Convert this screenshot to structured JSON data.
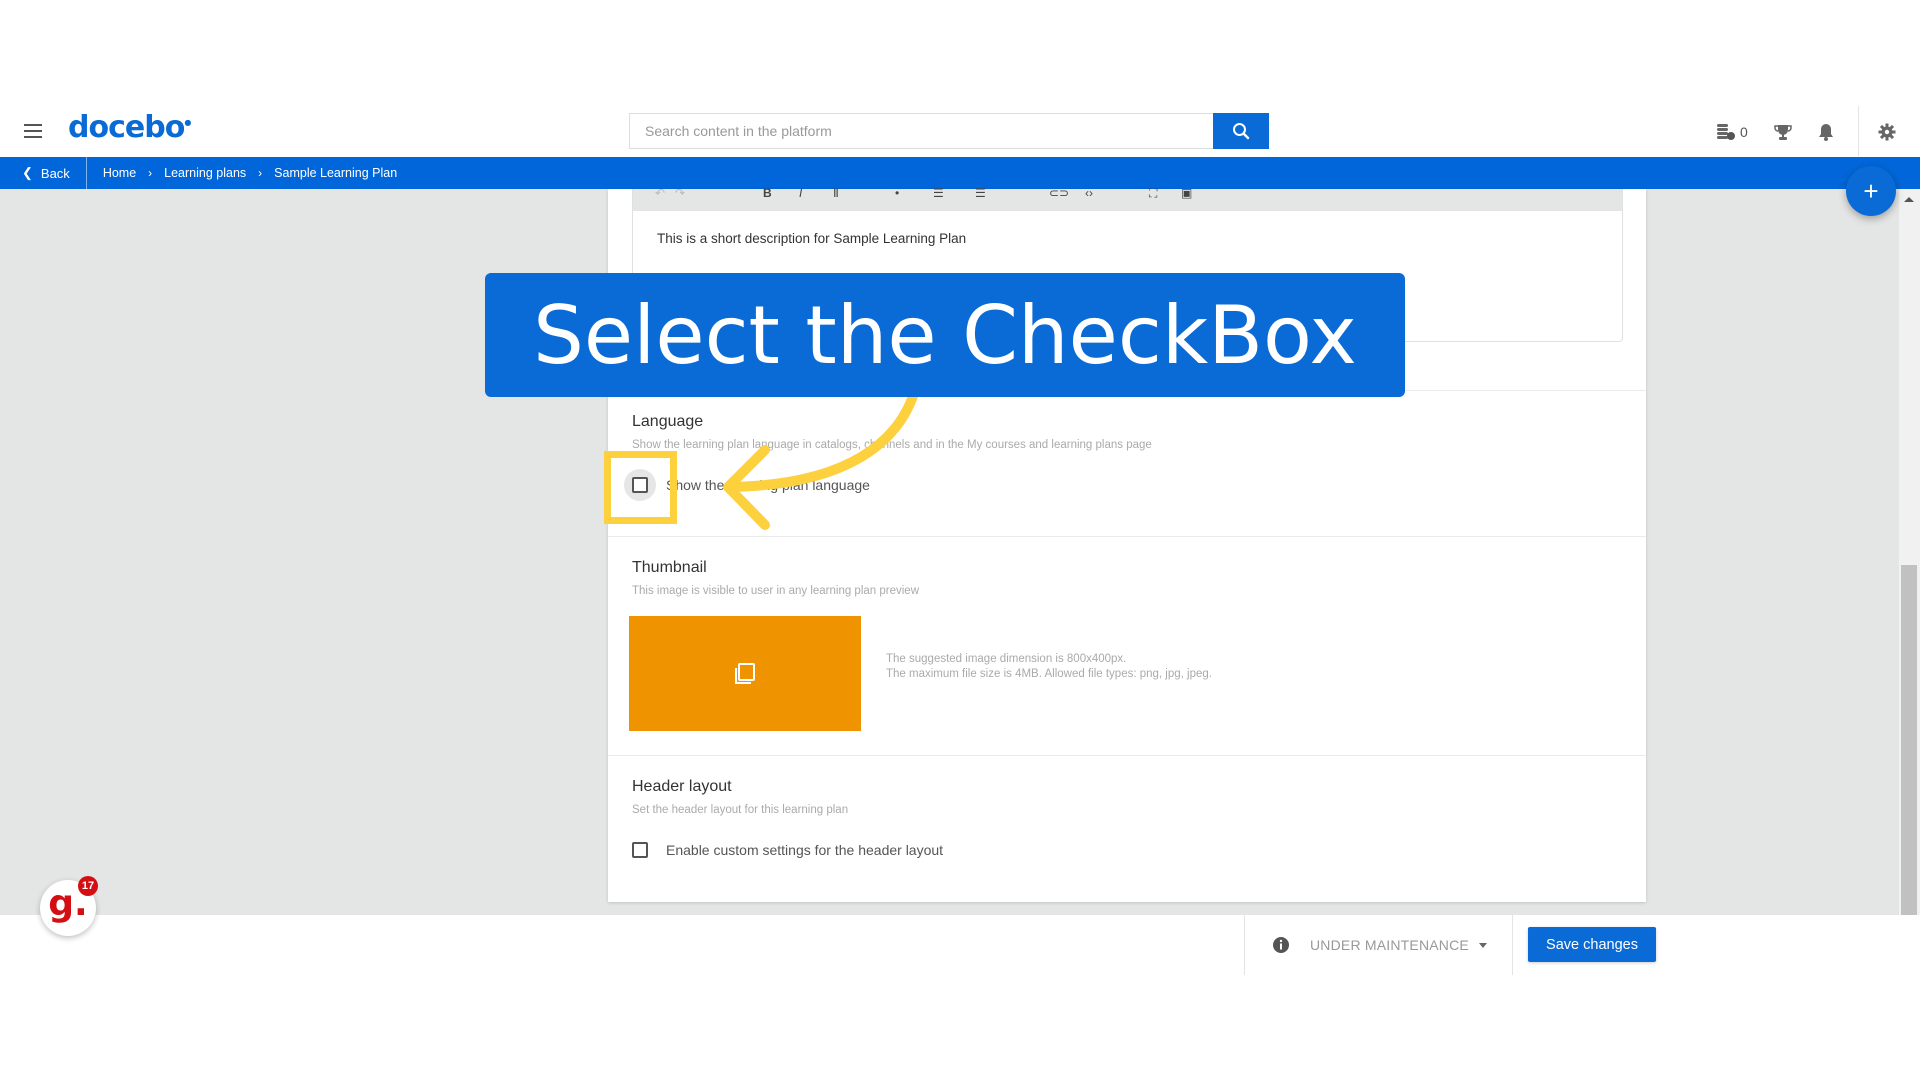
{
  "header": {
    "logo": "docebo",
    "search": {
      "placeholder": "Search content in the platform",
      "value": ""
    },
    "coins_count": "0",
    "icons": [
      "menu-icon",
      "search-icon",
      "coins-icon",
      "trophy-icon",
      "bell-icon",
      "gear-icon"
    ]
  },
  "breadcrumb": {
    "back_label": "Back",
    "items": [
      "Home",
      "Learning plans",
      "Sample Learning Plan"
    ]
  },
  "editor": {
    "content": "This is a short description for Sample Learning Plan"
  },
  "sections": {
    "language": {
      "title": "Language",
      "description": "Show the learning plan language in catalogs, channels and in the My courses and learning plans page",
      "checkbox_label": "Show the learning plan language",
      "checked": false
    },
    "thumbnail": {
      "title": "Thumbnail",
      "description": "This image is visible to user in any learning plan preview",
      "hint_line1": "The suggested image dimension is 800x400px.",
      "hint_line2": "The maximum file size is 4MB. Allowed file types: png, jpg, jpeg.",
      "color": "#f09300"
    },
    "header_layout": {
      "title": "Header layout",
      "description": "Set the header layout for this learning plan",
      "checkbox_label": "Enable custom settings for the header layout",
      "checked": false
    }
  },
  "footer": {
    "status": "UNDER MAINTENANCE",
    "save_label": "Save changes"
  },
  "fab_label": "+",
  "notification_badge": {
    "letter": "g.",
    "count": "17"
  },
  "overlay": {
    "callout_text": "Select the CheckBox",
    "callout_color": "#0a6bd6",
    "highlight_color": "#fdd13e"
  },
  "colors": {
    "brand": "#0a6bd6",
    "breadcrumb_bar": "#0066d9",
    "background": "#e4e5e5"
  }
}
